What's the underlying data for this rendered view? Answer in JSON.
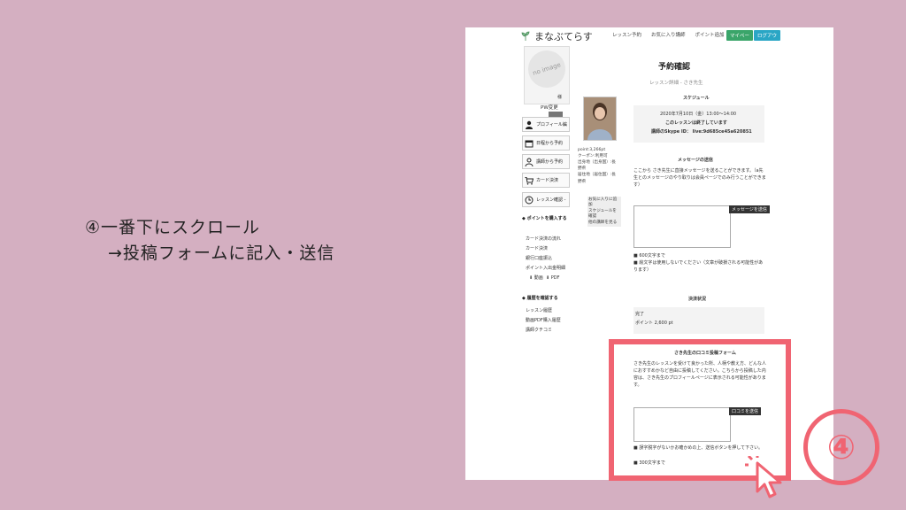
{
  "instruction": {
    "line1": "④一番下にスクロール",
    "line2": "→投稿フォームに記入・送信"
  },
  "app": {
    "logo_text": "まなぶてらす",
    "nav": [
      "レッスン予約",
      "お気に入り講師",
      "ポイント追加"
    ],
    "mypage_button": "マイペー",
    "logout_button": "ログアウ"
  },
  "sidebar": {
    "avatar_placeholder": "no image",
    "avatar_suffix": "様",
    "pw_change": "PW変更",
    "buttons": [
      "プロフィール編",
      "日程から予約",
      "講師から予約",
      "カード決済",
      "レッスン確認 -"
    ],
    "points_head": "ポイントを購入する",
    "points_links": [
      "カード決済の流れ",
      "カード決済",
      "銀行口座振込",
      "ポイント入出金明細"
    ],
    "download_labels": [
      "動画",
      "PDF"
    ],
    "history_head": "履歴を確認する",
    "history_links": [
      "レッスン履歴",
      "動画PDF購入履歴",
      "講師クチコミ"
    ]
  },
  "teacher": {
    "info_lines": [
      "point:3,266pt",
      "クーポン:利用可",
      "出身地（出身国）:長",
      "野県",
      "居住地（居住国）:長",
      "野県"
    ],
    "links": [
      "お気に入りに追加",
      "スケジュールを確認",
      "他の講師を見る"
    ]
  },
  "main": {
    "title": "予約確認",
    "subtitle": "レッスン詳細 - さき先生",
    "schedule_head": "スケジュール",
    "schedule_date": "2020年7月10日（金）13:00～14:00",
    "schedule_status": "このレッスンは終了しています",
    "skype": "講師のSkype ID： live:9d685ce45a620851",
    "message_head": "メッセージの送信",
    "message_desc": "ここから さき先生に直接メッセージを送ることができます。（a先生とのメッセージのやり取りは会員ページでのみ行うことができます）",
    "message_send": "メッセージを送信",
    "message_note1": "■ 600文字まで",
    "message_note2": "■ 絵文字は使用しないでください（文章が破損される可能性があります）",
    "payment_head": "決済状況",
    "payment_status": "完了",
    "payment_points": "ポイント 2,600 pt",
    "review_head": "さき先生の口コミ投稿フォーム",
    "review_desc": "さき先生のレッスンを受けて良かった所、人柄や教え方、どんな人におすすめかなど自由に投稿してください。こちらから投稿した内容は、さき先生のプロフィールページに表示される可能性があります。",
    "review_send": "口コミを送信",
    "review_note1": "■ 誤字脱字がないかお確かめの上、送信ボタンを押して下さい。",
    "review_note2": "■ 300文字まで"
  },
  "step_badge": "④"
}
